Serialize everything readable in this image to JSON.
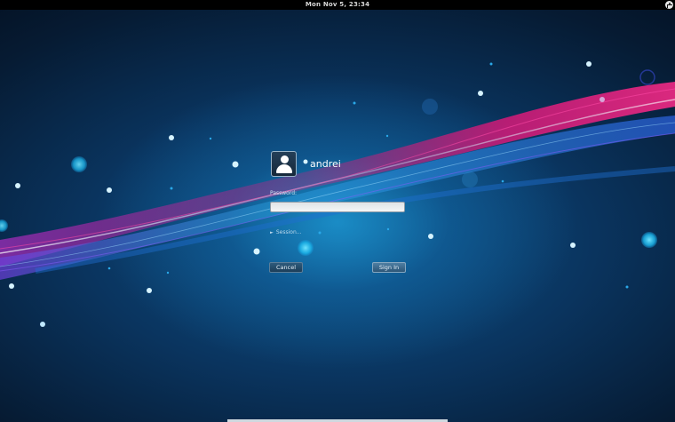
{
  "topbar": {
    "clock": "Mon Nov  5, 23:34",
    "accessibility_icon": "accessibility-icon"
  },
  "login": {
    "avatar_icon": "user-avatar-icon",
    "username": "andrei",
    "password_label": "Password:",
    "password_value": "",
    "session_label": "Session...",
    "session_arrow_icon": "expander-arrow-icon",
    "cancel_label": "Cancel",
    "signin_label": "Sign In"
  },
  "colors": {
    "background_dark": "#061a2c",
    "wave_pink": "#e0187a",
    "wave_purple": "#8a3fd0",
    "wave_blue": "#2a7bd8",
    "bubble_cyan": "#29c8f0"
  }
}
